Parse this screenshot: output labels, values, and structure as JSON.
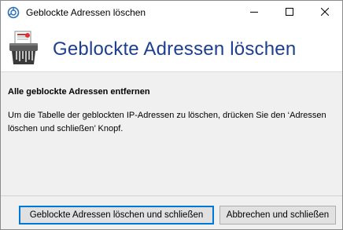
{
  "window": {
    "title": "Geblockte Adressen löschen",
    "icon": "app-shield-icon",
    "controls": {
      "minimize": "minimize-icon",
      "maximize": "maximize-icon",
      "close": "close-icon"
    }
  },
  "header": {
    "icon": "shredder-icon",
    "title": "Geblockte Adressen löschen",
    "title_color": "#1d3f8f"
  },
  "content": {
    "heading": "Alle geblockte Adressen entfernen",
    "description": "Um die Tabelle der geblockten IP-Adressen zu löschen, drücken Sie den ‘Adressen löschen und schließen’ Knopf."
  },
  "footer": {
    "primary_button": "Geblockte Adressen löschen und schließen",
    "secondary_button": "Abbrechen und schließen",
    "accent": "#0078d7"
  }
}
